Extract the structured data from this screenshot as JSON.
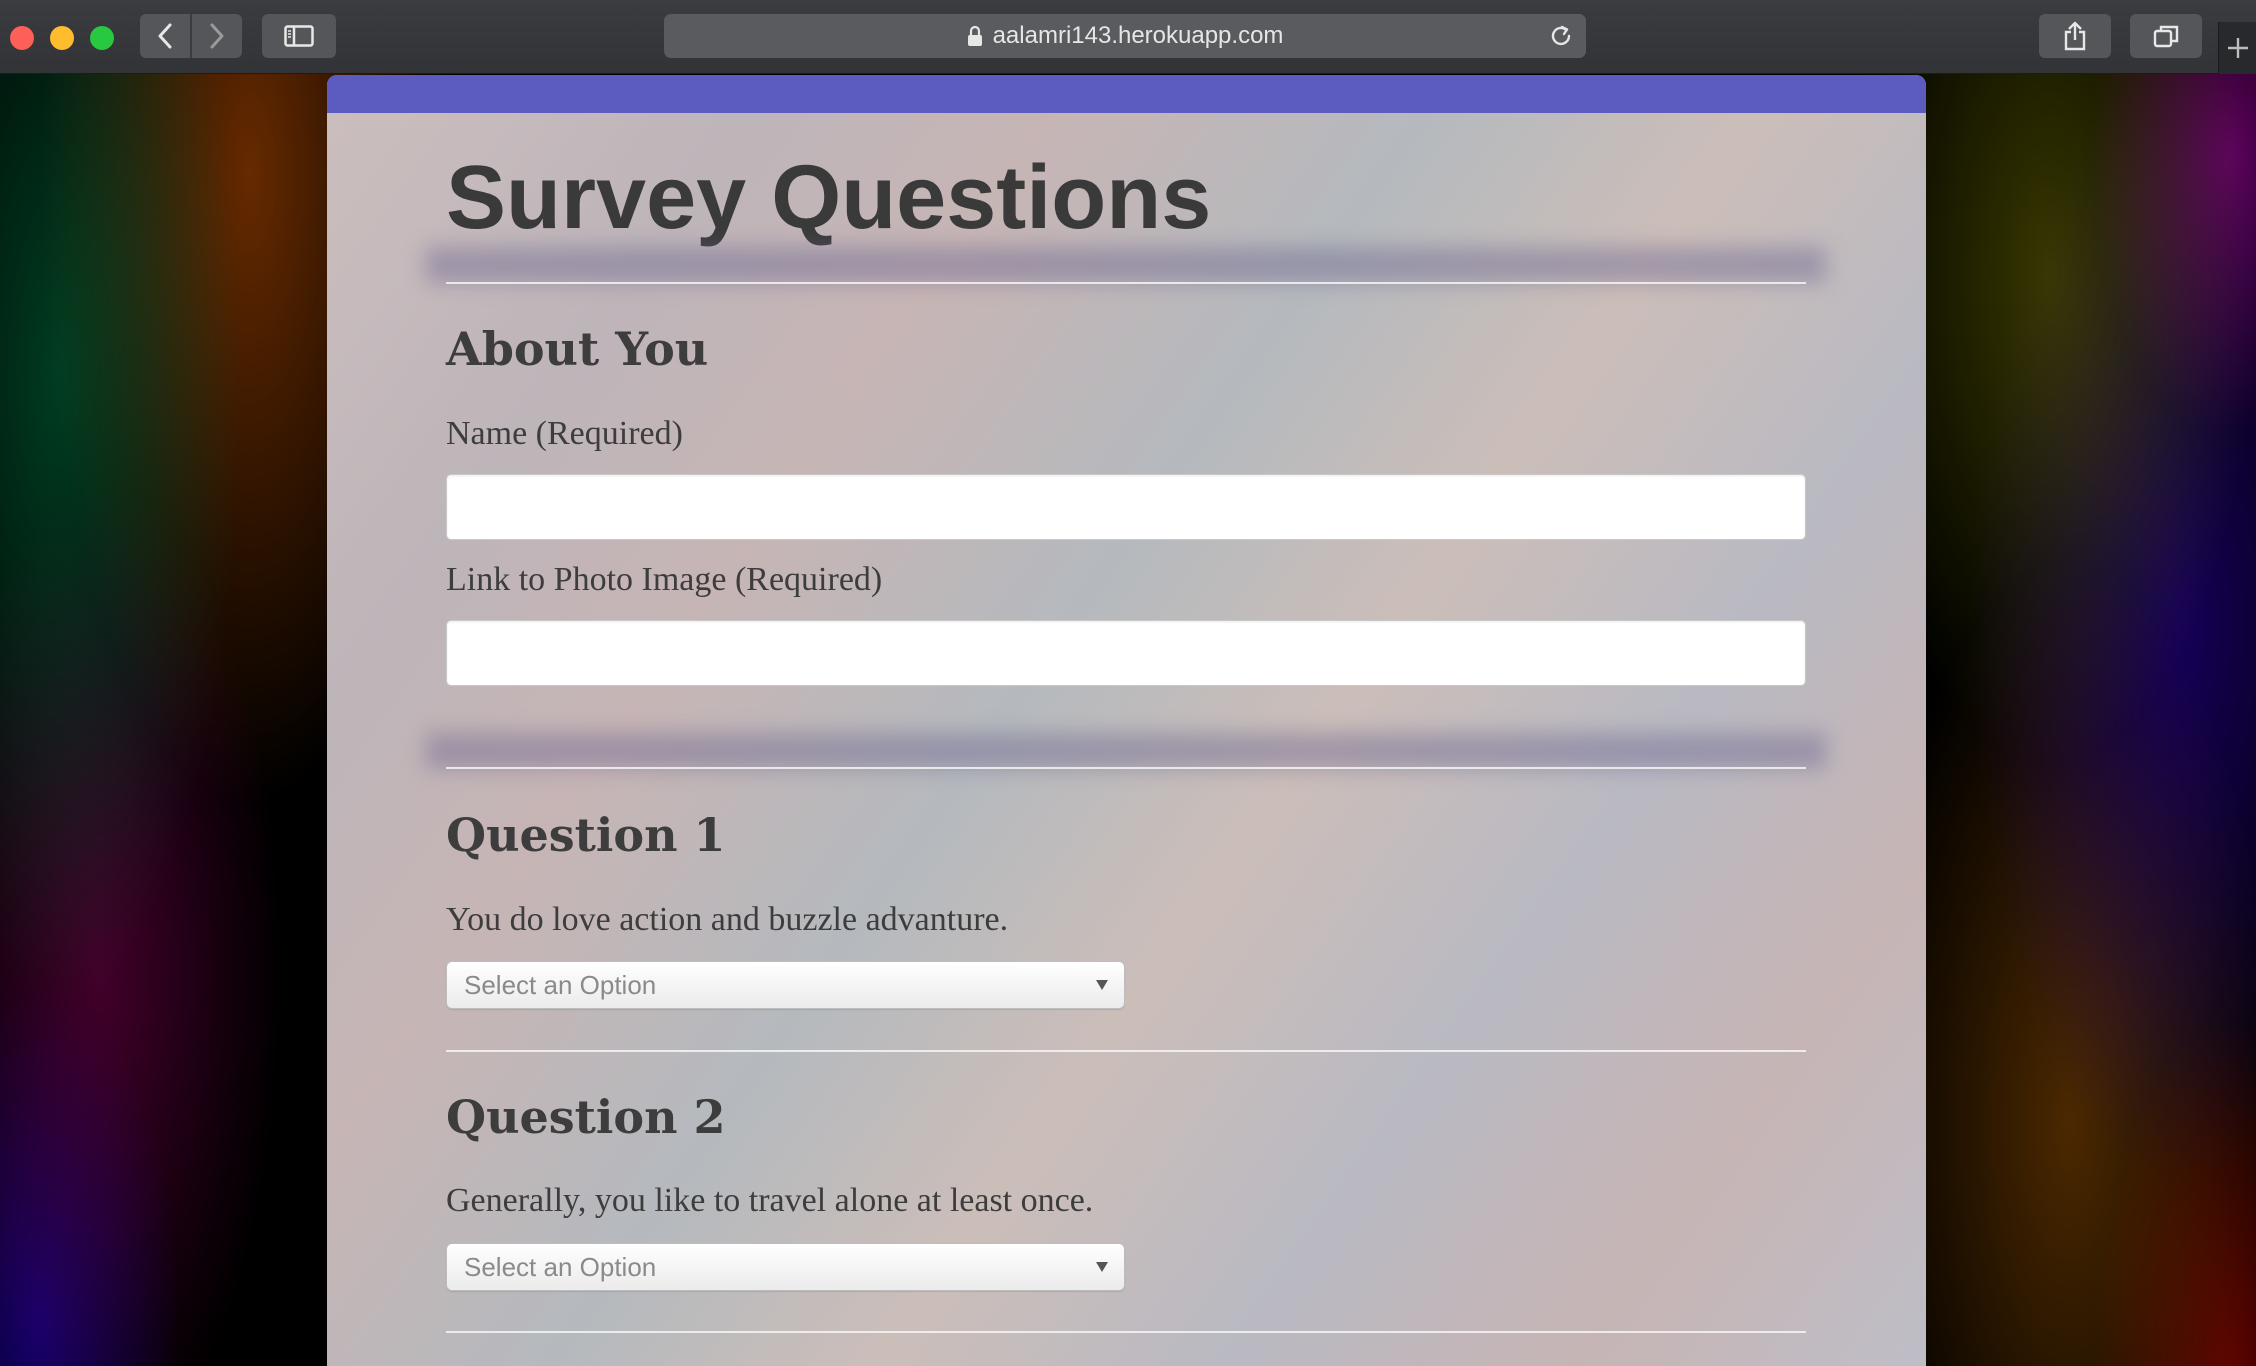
{
  "browser": {
    "url": "aalamri143.herokuapp.com",
    "icons": {
      "back": "chevron-left-icon",
      "forward": "chevron-right-icon",
      "sidebar": "sidebar-icon",
      "lock": "lock-icon",
      "reload": "reload-icon",
      "share": "share-icon",
      "tabs": "tabs-overview-icon",
      "new_tab": "plus-icon"
    }
  },
  "colors": {
    "accent_bar": "#5b5bc0",
    "text": "#3d3d3d",
    "rule": "#f5f5f5"
  },
  "page": {
    "title": "Survey Questions"
  },
  "about": {
    "heading": "About You",
    "name_label": "Name (Required)",
    "name_value": "",
    "photo_label": "Link to Photo Image (Required)",
    "photo_value": ""
  },
  "questions": [
    {
      "heading": "Question 1",
      "text": "You do love action and buzzle advanture.",
      "select_value": "Select an Option"
    },
    {
      "heading": "Question 2",
      "text": "Generally, you like to travel alone at least once.",
      "select_value": "Select an Option"
    }
  ]
}
